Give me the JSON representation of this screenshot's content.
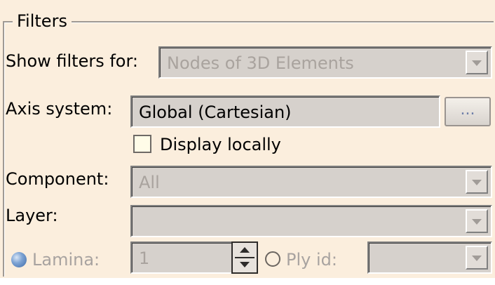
{
  "filters": {
    "group_title": "Filters",
    "show_filters_label": "Show filters for:",
    "show_filters_value": "Nodes of 3D Elements",
    "axis_system_label": "Axis system:",
    "axis_system_value": "Global (Cartesian)",
    "axis_button_label": "...",
    "display_locally_label": "Display locally",
    "display_locally_checked": false,
    "component_label": "Component:",
    "component_value": "All",
    "layer_label": "Layer:",
    "layer_value": "",
    "lamina_label": "Lamina:",
    "lamina_value": "1",
    "lamina_selected": true,
    "ply_id_label": "Ply id:",
    "ply_id_value": "",
    "ply_id_selected": false
  },
  "colors": {
    "panel_background": "#fbeedd",
    "field_background": "#d6d1cc",
    "disabled_text": "#a8a3a0",
    "radio_selected": "#3e6aa8"
  }
}
